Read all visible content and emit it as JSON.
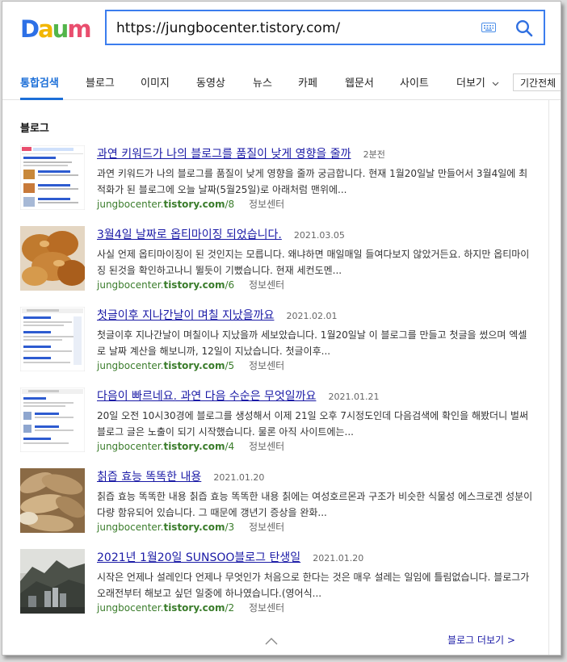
{
  "header": {
    "logo_text": "Daum",
    "search_value": "https://jungbocenter.tistory.com/",
    "keyboard_icon": "keyboard-icon",
    "search_icon": "magnifier-icon"
  },
  "tabs": [
    {
      "label": "통합검색",
      "active": true
    },
    {
      "label": "블로그"
    },
    {
      "label": "이미지"
    },
    {
      "label": "동영상"
    },
    {
      "label": "뉴스"
    },
    {
      "label": "카페"
    },
    {
      "label": "웹문서"
    },
    {
      "label": "사이트"
    }
  ],
  "more_tab": "더보기",
  "period_filter": "기간전체",
  "section_title": "블로그",
  "results": [
    {
      "title": "과연 키워드가 나의 블로그를 품질이 낮게 영향을 줄까",
      "time": "2분전",
      "snippet": "과연 키워드가 나의 블로그를 품질이 낮게 영향을 줄까 궁금합니다. 현재 1월20일날 만들어서 3월4일에 최적화가 된 블로그에 오늘 날짜(5월25일)로 아래처럼 맨위에...",
      "url_prefix": "jungbocenter.",
      "url_bold": "tistory.com",
      "url_suffix": "/8",
      "source": "정보센터"
    },
    {
      "title": "3월4일 날짜로 옵티마이징 되었습니다.",
      "time": "2021.03.05",
      "snippet": "사실 언제 옵티마이징이 된 것인지는 모릅니다. 왜냐하면 매일매일 들여다보지 않았거든요. 하지만 옵티마이징 된것을 확인하고나니 뛸듯이 기뻤습니다. 현재 세컨도멘...",
      "url_prefix": "jungbocenter.",
      "url_bold": "tistory.com",
      "url_suffix": "/6",
      "source": "정보센터"
    },
    {
      "title": "첫글이후 지나간날이 며칠 지났을까요",
      "time": "2021.02.01",
      "snippet": "첫글이후 지나간날이 며칠이나 지났을까 세보았습니다. 1월20일날 이 블로그를 만들고 첫글을 썼으며 엑셀로 날짜 계산을 해보니까, 12일이 지났습니다. 첫글이후...",
      "url_prefix": "jungbocenter.",
      "url_bold": "tistory.com",
      "url_suffix": "/5",
      "source": "정보센터"
    },
    {
      "title": "다음이 빠르네요. 과연 다음 수순은 무엇일까요",
      "time": "2021.01.21",
      "snippet": "20일 오전 10시30경에 블로그를 생성해서 이제 21일 오후 7시정도인데 다음검색에 확인을 해봤더니 벌써 블로그 글은 노출이 되기 시작했습니다. 물론 아직 사이트에는...",
      "url_prefix": "jungbocenter.",
      "url_bold": "tistory.com",
      "url_suffix": "/4",
      "source": "정보센터"
    },
    {
      "title": "칡즙 효능 똑똑한 내용",
      "time": "2021.01.20",
      "snippet": "칡즙 효능 똑똑한 내용 칡즙 효능 똑똑한 내용 칡에는 여성호르몬과 구조가 비슷한 식물성 에스크로겐 성분이 다량 함유되어 있습니다. 그 때문에 갱년기 증상을 완화...",
      "url_prefix": "jungbocenter.",
      "url_bold": "tistory.com",
      "url_suffix": "/3",
      "source": "정보센터"
    },
    {
      "title": "2021년 1월20일 SUNSOO블로그 탄생일",
      "time": "2021.01.20",
      "snippet": "시작은 언제나 설레인다 언제나 무엇인가 처음으로 한다는 것은 매우 설레는 일임에 틀림없습니다. 블로그가 오래전부터 해보고 싶던 일중에 하나였습니다.(영어식...",
      "url_prefix": "jungbocenter.",
      "url_bold": "tistory.com",
      "url_suffix": "/2",
      "source": "정보센터"
    }
  ],
  "more_link": "블로그 더보기 >",
  "colors": {
    "accent": "#1c6fd8",
    "link": "#1a1aa6",
    "url_green": "#3a7c2b",
    "search_border": "#3b7dee"
  }
}
